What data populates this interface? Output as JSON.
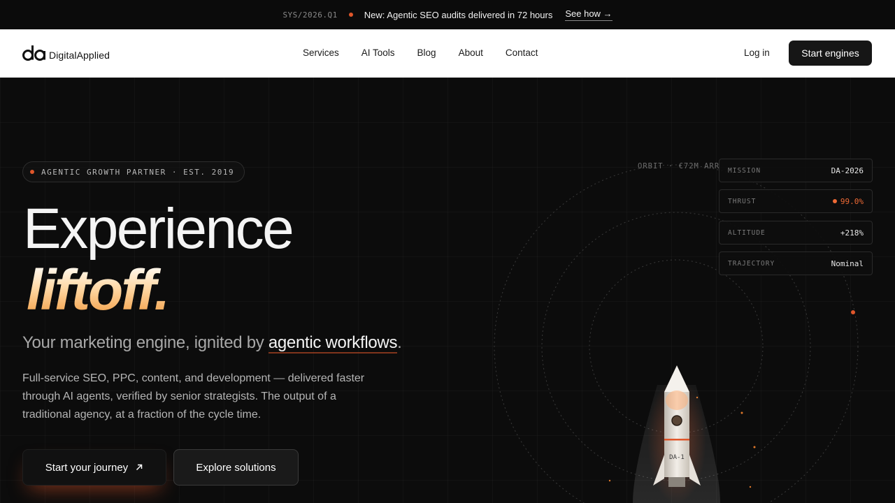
{
  "announcement": {
    "code": "SYS/2026.Q1",
    "message": "New: Agentic SEO audits delivered in 72 hours",
    "link_label": "See how →"
  },
  "nav": {
    "logo_text": "DigitalApplied",
    "links": [
      "Services",
      "AI Tools",
      "Blog",
      "About",
      "Contact"
    ],
    "login_label": "Log in",
    "cta_label": "Start engines"
  },
  "hero": {
    "badge": "AGENTIC GROWTH PARTNER · EST. 2019",
    "title_line1": "Experience",
    "title_line2": "liftoff.",
    "subtitle_prefix": "Your marketing engine, ignited by ",
    "subtitle_highlight": "agentic workflows",
    "subtitle_suffix": ".",
    "body": "Full-service SEO, PPC, content, and development — delivered faster through AI agents, verified by senior strategists. The output of a traditional agency, at a fraction of the cycle time.",
    "primary_cta": "Start your journey",
    "secondary_cta": "Explore solutions"
  },
  "telemetry": {
    "orbit_label": "ORBIT · €72M ARR",
    "rows": [
      {
        "key": "MISSION",
        "value": "DA-2026"
      },
      {
        "key": "THRUST",
        "value": "99.0%"
      },
      {
        "key": "ALTITUDE",
        "value": "+218%"
      },
      {
        "key": "TRAJECTORY",
        "value": "Nominal"
      }
    ],
    "rocket_label": "DA-1"
  },
  "colors": {
    "accent": "#e0562a",
    "background": "#0c0c0c",
    "nav_bg": "#ffffff"
  }
}
